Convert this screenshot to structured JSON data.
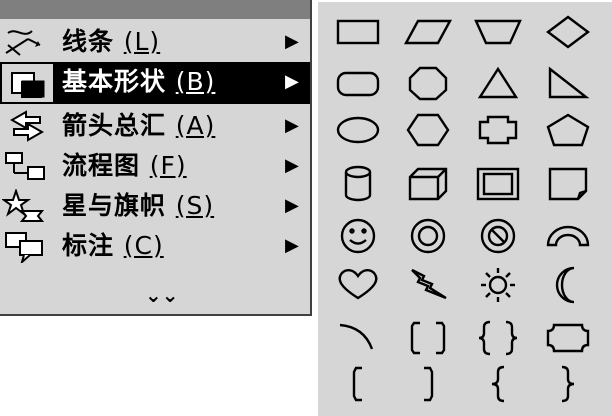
{
  "menu": {
    "items": [
      {
        "label": "线条",
        "key": "(L)",
        "icon": "lines-icon"
      },
      {
        "label": "基本形状",
        "key": "(B)",
        "icon": "basic-shapes-icon",
        "highlighted": true
      },
      {
        "label": "箭头总汇",
        "key": "(A)",
        "icon": "block-arrows-icon"
      },
      {
        "label": "流程图",
        "key": "(F)",
        "icon": "flowchart-icon"
      },
      {
        "label": "星与旗帜",
        "key": "(S)",
        "icon": "stars-banners-icon"
      },
      {
        "label": "标注",
        "key": "(C)",
        "icon": "callouts-icon"
      }
    ],
    "submenu_arrow": "▶",
    "expand_glyph": "⌄⌄"
  },
  "palette": {
    "shapes": [
      "rectangle-icon",
      "parallelogram-icon",
      "trapezoid-icon",
      "diamond-icon",
      "rounded-rectangle-icon",
      "octagon-icon",
      "isosceles-triangle-icon",
      "right-triangle-icon",
      "oval-icon",
      "hexagon-icon",
      "cross-icon",
      "pentagon-icon",
      "can-icon",
      "cube-icon",
      "bevel-icon",
      "folded-corner-icon",
      "smiley-face-icon",
      "donut-icon",
      "no-symbol-icon",
      "block-arc-icon",
      "heart-icon",
      "lightning-bolt-icon",
      "sun-icon",
      "moon-icon",
      "arc-icon",
      "double-bracket-icon",
      "double-brace-icon",
      "plaque-icon",
      "left-bracket-icon",
      "right-bracket-icon",
      "left-brace-icon",
      "right-brace-icon"
    ]
  },
  "colors": {
    "menu_bg": "#d6d6d6",
    "highlight_bg": "#000000",
    "highlight_text": "#ffffff",
    "titlebar": "#7f7f7f"
  }
}
